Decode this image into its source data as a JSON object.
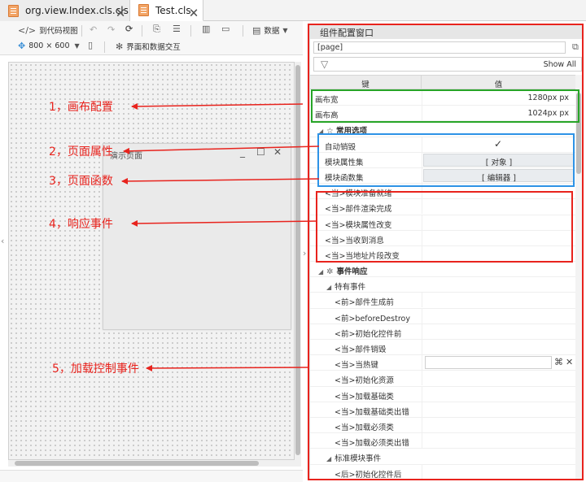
{
  "tabs": [
    {
      "label": "org.view.Index.cls.cls",
      "close": "🗙"
    },
    {
      "label": "Test.cls",
      "close": "🗙"
    }
  ],
  "toolbar": {
    "code_view": "到代码视图",
    "data": "数据",
    "size": "800 × 600",
    "interaction": "界面和数据交互",
    "icons": [
      "code-icon",
      "undo-icon",
      "redo-icon",
      "refresh-icon",
      "export-icon",
      "list-icon",
      "split-icon",
      "frame-icon",
      "data-icon",
      "move-icon",
      "phone-icon",
      "gear-icon"
    ]
  },
  "canvas": {
    "demo_title": "演示页面",
    "demo_controls": [
      "_",
      "☐",
      "✕"
    ]
  },
  "panel": {
    "title": "组件配置窗口",
    "path": "[page]",
    "show_all": "Show All",
    "col_key": "键",
    "col_value": "值",
    "rows": [
      {
        "key": "画布宽",
        "value": "1280px px"
      },
      {
        "key": "画布高",
        "value": "1024px px"
      },
      {
        "key": "☆ 常用选项"
      },
      {
        "key": "自动销毁",
        "value": "✓"
      },
      {
        "key": "模块属性集",
        "value": "[ 对象 ]"
      },
      {
        "key": "模块函数集",
        "value": "[ 编辑器 ]"
      },
      {
        "key": "<当>模块准备就绪"
      },
      {
        "key": "<当>部件渲染完成"
      },
      {
        "key": "<当>模块属性改变"
      },
      {
        "key": "<当>当收到消息"
      },
      {
        "key": "<当>当地址片段改变"
      },
      {
        "key": "事件响应"
      },
      {
        "key": "特有事件"
      },
      {
        "key": "<前>部件生成前"
      },
      {
        "key": "<前>beforeDestroy"
      },
      {
        "key": "<前>初始化控件前"
      },
      {
        "key": "<当>部件销毁"
      },
      {
        "key": "<当>当热键"
      },
      {
        "key": "<当>初始化资源"
      },
      {
        "key": "<当>加载基础类"
      },
      {
        "key": "<当>加载基础类出错"
      },
      {
        "key": "<当>加载必须类"
      },
      {
        "key": "<当>加载必须类出错"
      },
      {
        "key": "标准模块事件"
      },
      {
        "key": "<后>初始化控件后"
      }
    ]
  },
  "annotations": [
    {
      "label": "1，画布配置"
    },
    {
      "label": "2，页面属性"
    },
    {
      "label": "3，页面函数"
    },
    {
      "label": "4，响应事件"
    },
    {
      "label": "5，加载控制事件"
    }
  ],
  "colors": {
    "annotation_red": "#e8231d",
    "highlight_green": "#27a527",
    "highlight_blue": "#2e93e6",
    "tab_file_icon": "#f2a466"
  }
}
